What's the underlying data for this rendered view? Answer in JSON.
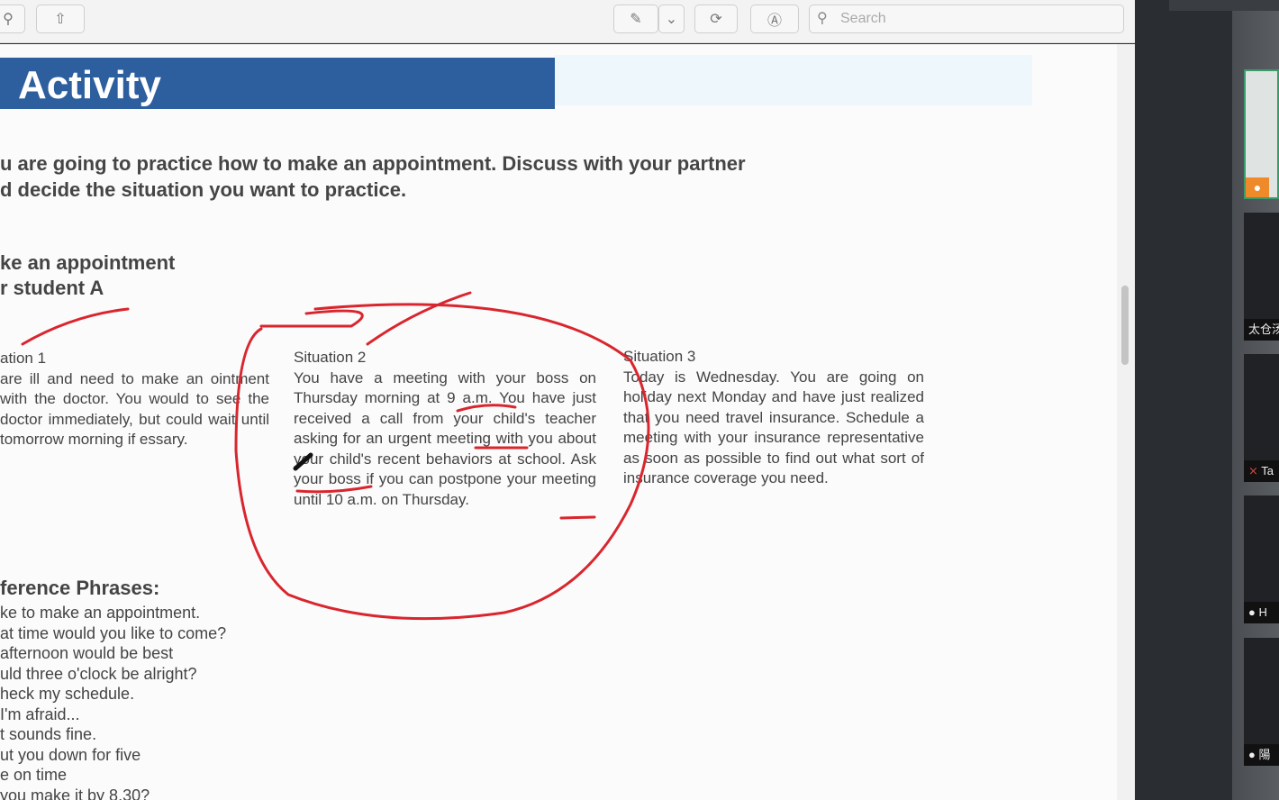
{
  "toolbar": {
    "search_placeholder": "Search",
    "icons": [
      "zoom-icon",
      "share-icon",
      "highlight-pen-icon",
      "chevron-down-icon",
      "rotate-icon",
      "markup-icon",
      "search-icon"
    ]
  },
  "document": {
    "banner_title": "Activity",
    "intro": [
      "u are going to practice how to make an appointment. Discuss with your partner",
      "d decide the situation you want to practice."
    ],
    "section_title": [
      "ke an appointment",
      "r student A"
    ],
    "situations": [
      {
        "title": "ation 1",
        "body": "are ill and need to make an ointment with the doctor. You would to see the doctor immediately, but could wait until tomorrow morning if essary."
      },
      {
        "title": "Situation 2",
        "body": "You have a meeting with your boss on Thursday morning at 9 a.m. You have just received a call from your child's teacher asking for an urgent meeting with you about your child's recent behaviors at school. Ask your boss if you can postpone your meeting until 10 a.m. on Thursday."
      },
      {
        "title": "Situation 3",
        "body": "Today is Wednesday. You are going on holiday next Monday and have just realized that you need travel insurance. Schedule a meeting with your insurance representative as soon as possible to find out what sort of insurance coverage you need."
      }
    ],
    "phrases_title": "ference Phrases:",
    "phrases": [
      "ke to make an appointment.",
      "at time would you like to come?",
      "afternoon would be best",
      "uld three o'clock be alright?",
      "heck my schedule.",
      "I'm afraid...",
      "t sounds fine.",
      "ut you down for five",
      "e on time",
      "you make it by 8.30?"
    ],
    "annotation_color": "#d9262e"
  },
  "participants": [
    {
      "label": "",
      "mic": "on",
      "video": true
    },
    {
      "label": "太仓汤"
    },
    {
      "label": "Ta",
      "mic": "muted"
    },
    {
      "label": "H",
      "mic": "on"
    },
    {
      "label": "陽",
      "mic": "on"
    }
  ]
}
